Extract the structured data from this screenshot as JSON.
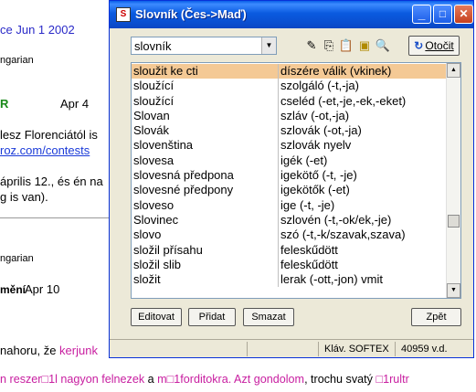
{
  "background": {
    "lines": [
      {
        "text": "ce Jun 1 2002",
        "color": "#2a2ac8"
      },
      {
        "text": "ngarian",
        "color": "#000000"
      },
      {
        "text": "R",
        "color": "#1a8a1a"
      },
      {
        "text": "Apr 4",
        "color": "#000000"
      },
      {
        "text": " lesz Florenciától is",
        "color": "#000000"
      },
      {
        "text": "roz.com/contests",
        "color": "#1a3ad8"
      },
      {
        "text": " április 12., és én na",
        "color": "#000000"
      },
      {
        "text": "g is van).",
        "color": "#000000"
      },
      {
        "text": "ngarian",
        "color": "#000000"
      },
      {
        "text": "mění",
        "color": "#000000"
      },
      {
        "text": "Apr 10",
        "color": "#000000"
      },
      {
        "text": " nahoru, že ",
        "color": "#000000"
      },
      {
        "text": "kerjunk",
        "color": "#c81ea0"
      },
      {
        "text": "n reszer□1l nagyon felnezek",
        "color": "#c81ea0"
      },
      {
        "text": " a ",
        "color": "#000000"
      },
      {
        "text": "m□1forditokra. Azt gondolom",
        "color": "#c81ea0"
      },
      {
        "text": ", trochu svatý ",
        "color": "#000000"
      },
      {
        "text": "□1rultr",
        "color": "#c81ea0"
      }
    ]
  },
  "window": {
    "title": "Slovník (Čes->Maď)",
    "titlebar_color": "#0a55dc",
    "buttons": {
      "minimize": "_",
      "maximize": "□",
      "close": "✕"
    }
  },
  "toolbar": {
    "search_value": "slovník",
    "icons": [
      "eraser-icon",
      "copy-icon",
      "paste-icon",
      "folder-icon",
      "find-icon"
    ],
    "otocit_label": "Otočit"
  },
  "list": {
    "selected_color": "#f4c995",
    "rows": [
      {
        "cz": "sloužit ke cti",
        "hu": "díszére válik (vkinek)",
        "selected": true
      },
      {
        "cz": "sloužící",
        "hu": "szolgáló (-t,-ja)"
      },
      {
        "cz": "sloužící",
        "hu": "cseléd (-et,-je,-ek,-eket)"
      },
      {
        "cz": "Slovan",
        "hu": "szláv (-ot,-ja)"
      },
      {
        "cz": "Slovák",
        "hu": "szlovák (-ot,-ja)"
      },
      {
        "cz": "slovenština",
        "hu": "szlovák nyelv"
      },
      {
        "cz": "slovesa",
        "hu": "igék (-et)"
      },
      {
        "cz": "slovesná předpona",
        "hu": "igekötő (-t, -je)"
      },
      {
        "cz": "slovesné předpony",
        "hu": "igekötők (-et)"
      },
      {
        "cz": "sloveso",
        "hu": "ige (-t, -je)"
      },
      {
        "cz": "Slovinec",
        "hu": "szlovén (-t,-ok/ek,-je)"
      },
      {
        "cz": "slovo",
        "hu": "szó (-t,-k/szavak,szava)"
      },
      {
        "cz": "složil přísahu",
        "hu": "feleskűdött"
      },
      {
        "cz": "složil slib",
        "hu": "feleskűdött"
      },
      {
        "cz": "složit",
        "hu": "lerak (-ott,-jon) vmit"
      }
    ]
  },
  "buttons": {
    "editovat": "Editovat",
    "pridat": "Přidat",
    "smazat": "Smazat",
    "zpet": "Zpět"
  },
  "status": {
    "left": "",
    "source": "Kláv. SOFTEX",
    "count": "40959 v.d."
  }
}
